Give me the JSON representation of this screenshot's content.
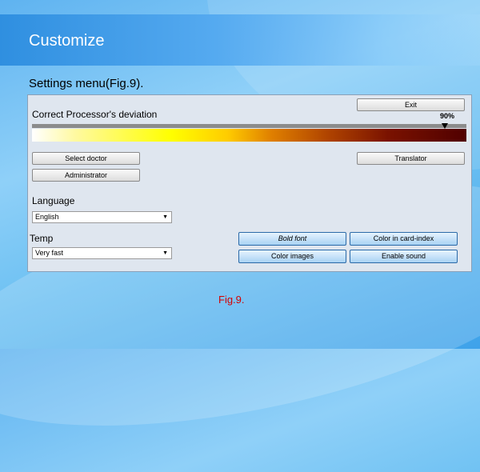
{
  "slide": {
    "title": "Customize",
    "subtitle": "Settings menu(Fig.9).",
    "caption": "Fig.9."
  },
  "settings": {
    "exit_label": "Exit",
    "deviation_label": "Correct Processor's deviation",
    "deviation_value": "90%",
    "deviation_fraction": 0.9,
    "select_doctor_label": "Select doctor",
    "administrator_label": "Administrator",
    "translator_label": "Translator",
    "language_label": "Language",
    "language_value": "English",
    "temp_label": "Temp",
    "temp_value": "Very fast",
    "bold_font_label": "Bold font",
    "color_card_index_label": "Color in card-index",
    "color_images_label": "Color images",
    "enable_sound_label": "Enable sound",
    "dropdown_arrow": "▼"
  },
  "colors": {
    "caption": "#d40000",
    "title": "#ffffff",
    "accent": "#2b6aa8"
  }
}
